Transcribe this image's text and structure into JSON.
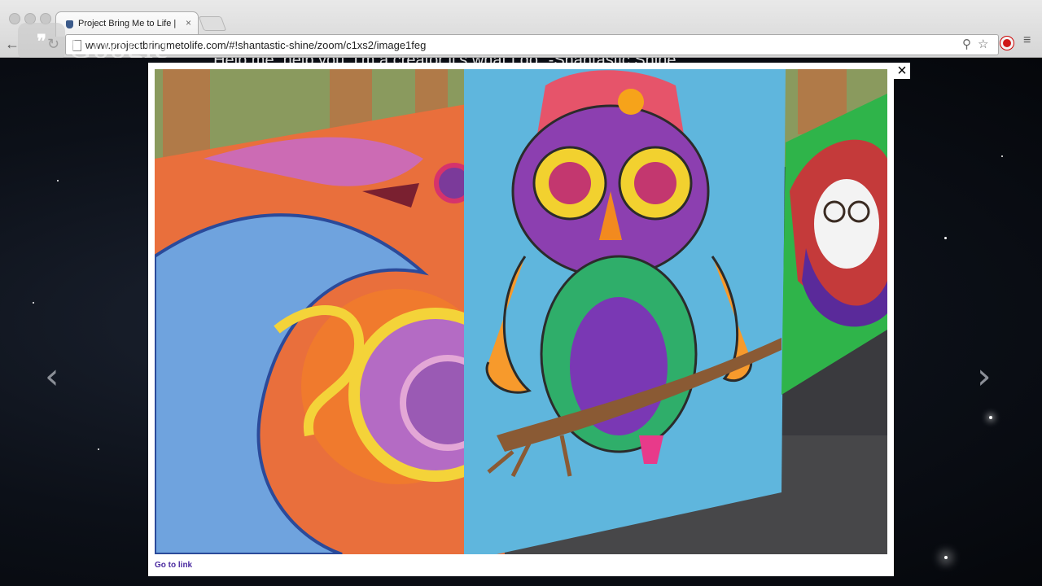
{
  "browser": {
    "tab_title": "Project Bring Me to Life | S",
    "tab_close": "×",
    "url": "www.projectbringmetolife.com/#!shantastic-shine/zoom/c1xs2/image1feg",
    "watermark": "Google"
  },
  "page": {
    "quote": "\"Help me, help you. I'm a creator it's what I do\" -Shantastic Shine",
    "prev_arrow": "‹",
    "next_arrow": "›"
  },
  "lightbox": {
    "close_label": "×",
    "link_text": "Go to link"
  },
  "colors": {
    "extension_red": "#d01818",
    "link_purple": "#4a2aa0"
  }
}
